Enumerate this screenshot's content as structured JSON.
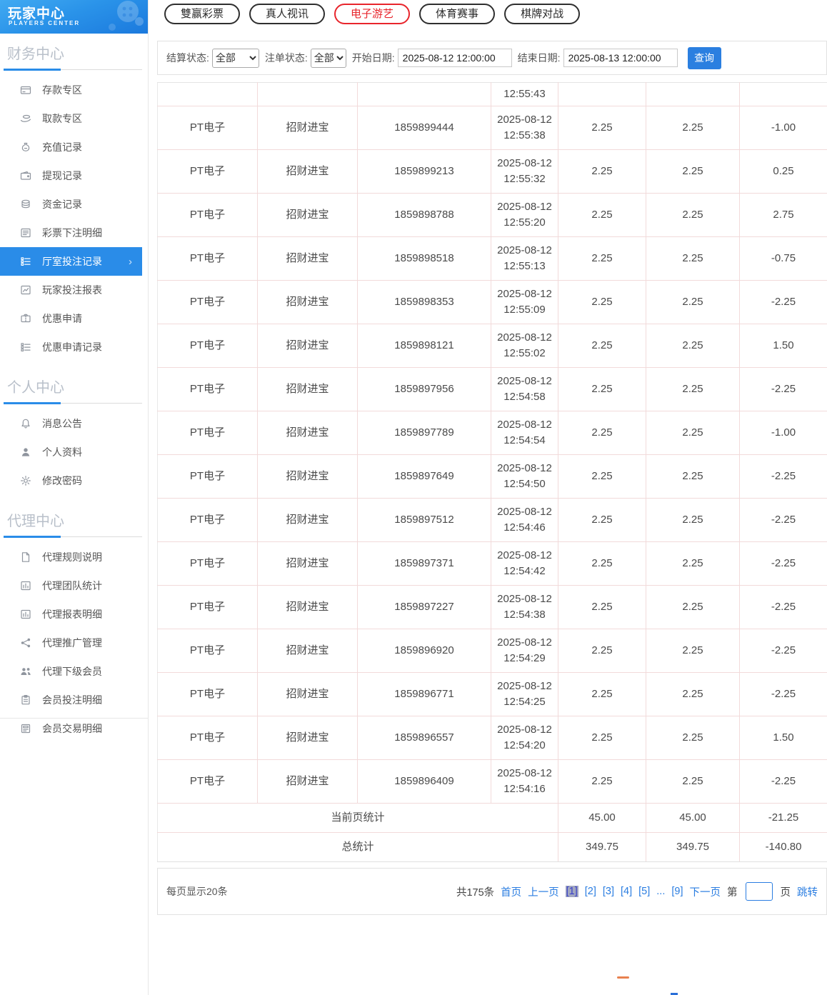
{
  "colors": {
    "accent_blue": "#2a8ce8",
    "tab_active_red": "#e8252c",
    "link_blue": "#2a7de1",
    "query_button_blue": "#2b7fe0",
    "table_border_pink": "#f2dada",
    "current_page_bg": "#a2a7c0"
  },
  "sidebar": {
    "title": "玩家中心",
    "subtitle": "PLAYERS CENTER",
    "sections": [
      {
        "title": "财务中心",
        "items": [
          {
            "name": "deposit-zone",
            "label": "存款专区",
            "icon": "deposit-card-icon",
            "active": false
          },
          {
            "name": "withdraw-zone",
            "label": "取款专区",
            "icon": "withdraw-hand-icon",
            "active": false
          },
          {
            "name": "recharge-record",
            "label": "充值记录",
            "icon": "recharge-bag-icon",
            "active": false
          },
          {
            "name": "withdraw-record",
            "label": "提现记录",
            "icon": "wallet-icon",
            "active": false
          },
          {
            "name": "funds-record",
            "label": "资金记录",
            "icon": "coins-icon",
            "active": false
          },
          {
            "name": "lottery-bet-detail",
            "label": "彩票下注明细",
            "icon": "doc-lines-icon",
            "active": false
          },
          {
            "name": "hall-bet-record",
            "label": "厅室投注记录",
            "icon": "list-icon",
            "active": true
          },
          {
            "name": "player-bet-report",
            "label": "玩家投注报表",
            "icon": "line-chart-icon",
            "active": false
          },
          {
            "name": "promo-apply",
            "label": "优惠申请",
            "icon": "ticket-icon",
            "active": false
          },
          {
            "name": "promo-apply-record",
            "label": "优惠申请记录",
            "icon": "list-icon",
            "active": false
          }
        ]
      },
      {
        "title": "个人中心",
        "items": [
          {
            "name": "message-notice",
            "label": "消息公告",
            "icon": "bell-icon",
            "active": false
          },
          {
            "name": "personal-profile",
            "label": "个人资料",
            "icon": "person-icon",
            "active": false
          },
          {
            "name": "change-password",
            "label": "修改密码",
            "icon": "gear-icon",
            "active": false
          }
        ]
      },
      {
        "title": "代理中心",
        "items": [
          {
            "name": "agent-rules",
            "label": "代理规则说明",
            "icon": "document-icon",
            "active": false
          },
          {
            "name": "agent-team-stats",
            "label": "代理团队统计",
            "icon": "bar-chart-icon",
            "active": false
          },
          {
            "name": "agent-report-detail",
            "label": "代理报表明细",
            "icon": "bar-chart-icon",
            "active": false
          },
          {
            "name": "agent-promo-manage",
            "label": "代理推广管理",
            "icon": "share-icon",
            "active": false
          },
          {
            "name": "agent-sub-members",
            "label": "代理下级会员",
            "icon": "users-icon",
            "active": false
          },
          {
            "name": "member-bet-detail",
            "label": "会员投注明细",
            "icon": "clipboard-icon",
            "active": false
          },
          {
            "name": "member-trans-detail",
            "label": "会员交易明细",
            "icon": "receipt-icon",
            "active": false
          }
        ]
      }
    ]
  },
  "tabs": [
    {
      "name": "lottery",
      "label": "雙赢彩票",
      "active": false
    },
    {
      "name": "live-video",
      "label": "真人视讯",
      "active": false
    },
    {
      "name": "e-games",
      "label": "电子游艺",
      "active": true
    },
    {
      "name": "sports",
      "label": "体育赛事",
      "active": false
    },
    {
      "name": "board-games",
      "label": "棋牌对战",
      "active": false
    }
  ],
  "filters": {
    "settle_status_label": "结算状态:",
    "settle_status_value": "全部",
    "order_status_label": "注单状态:",
    "order_status_value": "全部",
    "start_date_label": "开始日期:",
    "start_date_value": "2025-08-12 12:00:00",
    "end_date_label": "结束日期:",
    "end_date_value": "2025-08-13 12:00:00",
    "query_button": "查询"
  },
  "table": {
    "partial_row_time": "12:55:43",
    "rows": [
      {
        "hall": "PT电子",
        "game": "招财进宝",
        "order": "1859899444",
        "date": "2025-08-12",
        "time": "12:55:38",
        "bet": "2.25",
        "valid": "2.25",
        "result": "-1.00"
      },
      {
        "hall": "PT电子",
        "game": "招财进宝",
        "order": "1859899213",
        "date": "2025-08-12",
        "time": "12:55:32",
        "bet": "2.25",
        "valid": "2.25",
        "result": "0.25"
      },
      {
        "hall": "PT电子",
        "game": "招财进宝",
        "order": "1859898788",
        "date": "2025-08-12",
        "time": "12:55:20",
        "bet": "2.25",
        "valid": "2.25",
        "result": "2.75"
      },
      {
        "hall": "PT电子",
        "game": "招财进宝",
        "order": "1859898518",
        "date": "2025-08-12",
        "time": "12:55:13",
        "bet": "2.25",
        "valid": "2.25",
        "result": "-0.75"
      },
      {
        "hall": "PT电子",
        "game": "招财进宝",
        "order": "1859898353",
        "date": "2025-08-12",
        "time": "12:55:09",
        "bet": "2.25",
        "valid": "2.25",
        "result": "-2.25"
      },
      {
        "hall": "PT电子",
        "game": "招财进宝",
        "order": "1859898121",
        "date": "2025-08-12",
        "time": "12:55:02",
        "bet": "2.25",
        "valid": "2.25",
        "result": "1.50"
      },
      {
        "hall": "PT电子",
        "game": "招财进宝",
        "order": "1859897956",
        "date": "2025-08-12",
        "time": "12:54:58",
        "bet": "2.25",
        "valid": "2.25",
        "result": "-2.25"
      },
      {
        "hall": "PT电子",
        "game": "招财进宝",
        "order": "1859897789",
        "date": "2025-08-12",
        "time": "12:54:54",
        "bet": "2.25",
        "valid": "2.25",
        "result": "-1.00"
      },
      {
        "hall": "PT电子",
        "game": "招财进宝",
        "order": "1859897649",
        "date": "2025-08-12",
        "time": "12:54:50",
        "bet": "2.25",
        "valid": "2.25",
        "result": "-2.25"
      },
      {
        "hall": "PT电子",
        "game": "招财进宝",
        "order": "1859897512",
        "date": "2025-08-12",
        "time": "12:54:46",
        "bet": "2.25",
        "valid": "2.25",
        "result": "-2.25"
      },
      {
        "hall": "PT电子",
        "game": "招财进宝",
        "order": "1859897371",
        "date": "2025-08-12",
        "time": "12:54:42",
        "bet": "2.25",
        "valid": "2.25",
        "result": "-2.25"
      },
      {
        "hall": "PT电子",
        "game": "招财进宝",
        "order": "1859897227",
        "date": "2025-08-12",
        "time": "12:54:38",
        "bet": "2.25",
        "valid": "2.25",
        "result": "-2.25"
      },
      {
        "hall": "PT电子",
        "game": "招财进宝",
        "order": "1859896920",
        "date": "2025-08-12",
        "time": "12:54:29",
        "bet": "2.25",
        "valid": "2.25",
        "result": "-2.25"
      },
      {
        "hall": "PT电子",
        "game": "招财进宝",
        "order": "1859896771",
        "date": "2025-08-12",
        "time": "12:54:25",
        "bet": "2.25",
        "valid": "2.25",
        "result": "-2.25"
      },
      {
        "hall": "PT电子",
        "game": "招财进宝",
        "order": "1859896557",
        "date": "2025-08-12",
        "time": "12:54:20",
        "bet": "2.25",
        "valid": "2.25",
        "result": "1.50"
      },
      {
        "hall": "PT电子",
        "game": "招财进宝",
        "order": "1859896409",
        "date": "2025-08-12",
        "time": "12:54:16",
        "bet": "2.25",
        "valid": "2.25",
        "result": "-2.25"
      }
    ],
    "page_summary": {
      "label": "当前页统计",
      "bet": "45.00",
      "valid": "45.00",
      "result": "-21.25"
    },
    "total_summary": {
      "label": "总统计",
      "bet": "349.75",
      "valid": "349.75",
      "result": "-140.80"
    }
  },
  "pagination": {
    "per_page": "每页显示20条",
    "total": "共175条",
    "first": "首页",
    "prev": "上一页",
    "pages": [
      {
        "text": "[1]",
        "current": true
      },
      {
        "text": "[2]",
        "current": false
      },
      {
        "text": "[3]",
        "current": false
      },
      {
        "text": "[4]",
        "current": false
      },
      {
        "text": "[5]",
        "current": false
      },
      {
        "text": "...",
        "current": false
      },
      {
        "text": "[9]",
        "current": false
      }
    ],
    "next": "下一页",
    "jump_prefix": "第",
    "jump_value": "",
    "jump_suffix": "页",
    "jump_button": "跳转"
  }
}
